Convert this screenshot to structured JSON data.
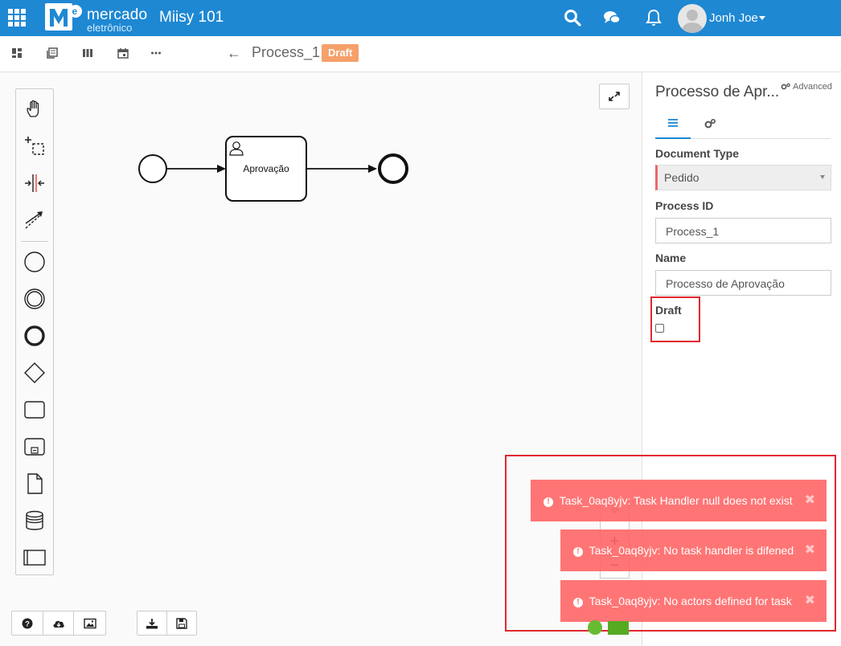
{
  "header": {
    "logo_line1": "mercado",
    "logo_line2": "eletrônico",
    "logo_mark": "Me",
    "app_title": "Miisy 101",
    "username": "Jonh Joe"
  },
  "toolbar": {
    "back_symbol": "←",
    "process_title": "Process_1",
    "status_badge": "Draft"
  },
  "diagram": {
    "task_label": "Aprovação"
  },
  "panel": {
    "title": "Processo de Apr...",
    "advanced_label": "Advanced",
    "document_type_label": "Document Type",
    "document_type_value": "Pedido",
    "process_id_label": "Process ID",
    "process_id_value": "Process_1",
    "name_label": "Name",
    "name_value": "Processo de Aprovação",
    "draft_label": "Draft",
    "draft_checked": false
  },
  "toasts": [
    {
      "text": "Task_0aq8yjv: Task Handler null does not exist"
    },
    {
      "text": "Task_0aq8yjv: No task handler is difened"
    },
    {
      "text": "Task_0aq8yjv: No actors defined for task"
    }
  ],
  "zoom": {
    "in": "+",
    "out": "−"
  },
  "icons": {
    "apps": "apps-icon",
    "search": "search-icon",
    "chat": "chat-icon",
    "bell": "bell-icon",
    "hand": "hand-tool-icon",
    "lasso": "lasso-tool-icon",
    "space": "space-tool-icon",
    "connect": "connect-tool-icon"
  },
  "colors": {
    "topbar": "#1e88d3",
    "badge": "#f6a06a",
    "toast": "#ff6666",
    "highlight": "#e0282e"
  }
}
